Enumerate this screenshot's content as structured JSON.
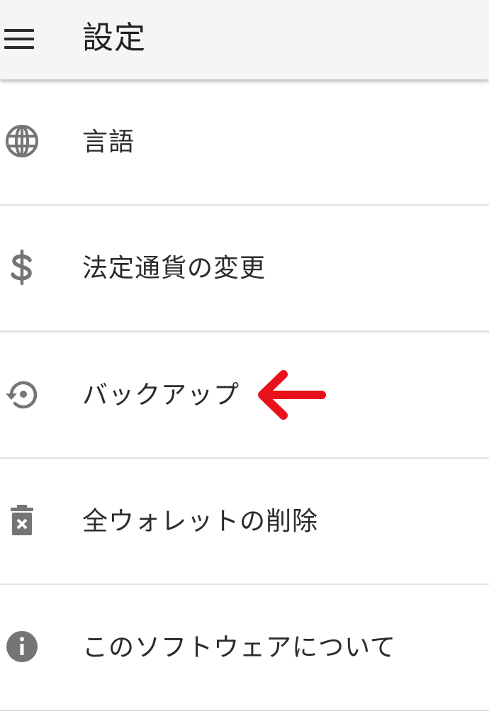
{
  "header": {
    "title": "設定"
  },
  "menu": {
    "items": [
      {
        "label": "言語",
        "icon": "globe-icon"
      },
      {
        "label": "法定通貨の変更",
        "icon": "dollar-icon"
      },
      {
        "label": "バックアップ",
        "icon": "restore-icon"
      },
      {
        "label": "全ウォレットの削除",
        "icon": "delete-icon"
      },
      {
        "label": "このソフトウェアについて",
        "icon": "info-icon"
      }
    ]
  },
  "colors": {
    "appbar": "#f5f5f5",
    "icon": "#757575",
    "divider": "#e0e0e0",
    "annotation_arrow": "#e8111b"
  }
}
